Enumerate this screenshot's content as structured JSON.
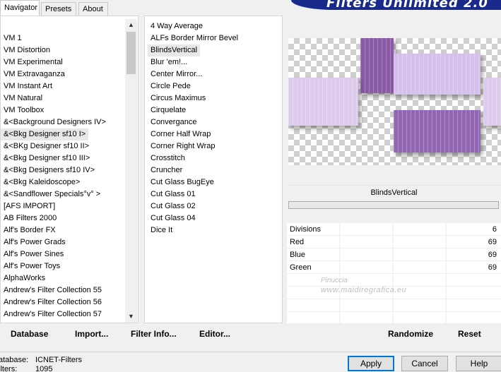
{
  "tabs": [
    {
      "label": "Navigator",
      "active": true
    },
    {
      "label": "Presets",
      "active": false
    },
    {
      "label": "About",
      "active": false
    }
  ],
  "banner": {
    "title": "Filters Unlimited 2.0"
  },
  "categories": {
    "items": [
      "VM 1",
      "VM Distortion",
      "VM Experimental",
      "VM Extravaganza",
      "VM Instant Art",
      "VM Natural",
      "VM Toolbox",
      "&<Background Designers IV>",
      "&<Bkg Designer sf10 I>",
      "&<BKg Designer sf10 II>",
      "&<Bkg Designer sf10 III>",
      "&<Bkg Designers sf10 IV>",
      "&<Bkg Kaleidoscope>",
      "&<Sandflower Specials°v° >",
      "[AFS IMPORT]",
      "AB Filters 2000",
      "Alf's Border FX",
      "Alf's Power Grads",
      "Alf's Power Sines",
      "Alf's Power Toys",
      "AlphaWorks",
      "Andrew's Filter Collection 55",
      "Andrew's Filter Collection 56",
      "Andrew's Filter Collection 57"
    ],
    "selected_index": 8
  },
  "filters": {
    "items": [
      "4 Way Average",
      "ALFs Border Mirror Bevel",
      "BlindsVertical",
      "Blur 'em!...",
      "Center Mirror...",
      "Circle Pede",
      "Circus Maximus",
      "Cirquelate",
      "Convergance",
      "Corner Half Wrap",
      "Corner Right Wrap",
      "Crosstitch",
      "Cruncher",
      "Cut Glass  BugEye",
      "Cut Glass 01",
      "Cut Glass 02",
      "Cut Glass 04",
      "Dice It"
    ],
    "selected_index": 2
  },
  "preview": {
    "accent": "#8a5aa8",
    "light": "#dccbec"
  },
  "filter_name": "BlindsVertical",
  "params": [
    {
      "label": "Divisions",
      "value": "6"
    },
    {
      "label": "Red",
      "value": "69"
    },
    {
      "label": "Blue",
      "value": "69"
    },
    {
      "label": "Green",
      "value": "69"
    }
  ],
  "watermark": {
    "line1": "Pinuccia",
    "line2": "www.maidiregrafica.eu"
  },
  "toolbar": {
    "database": "Database",
    "import": "Import...",
    "filter_info": "Filter Info...",
    "editor": "Editor...",
    "randomize": "Randomize",
    "reset": "Reset"
  },
  "status": {
    "database_key": "atabase:",
    "database_value": "ICNET-Filters",
    "filters_key": "ilters:",
    "filters_value": "1095"
  },
  "dialog": {
    "apply": "Apply",
    "cancel": "Cancel",
    "help": "Help"
  }
}
